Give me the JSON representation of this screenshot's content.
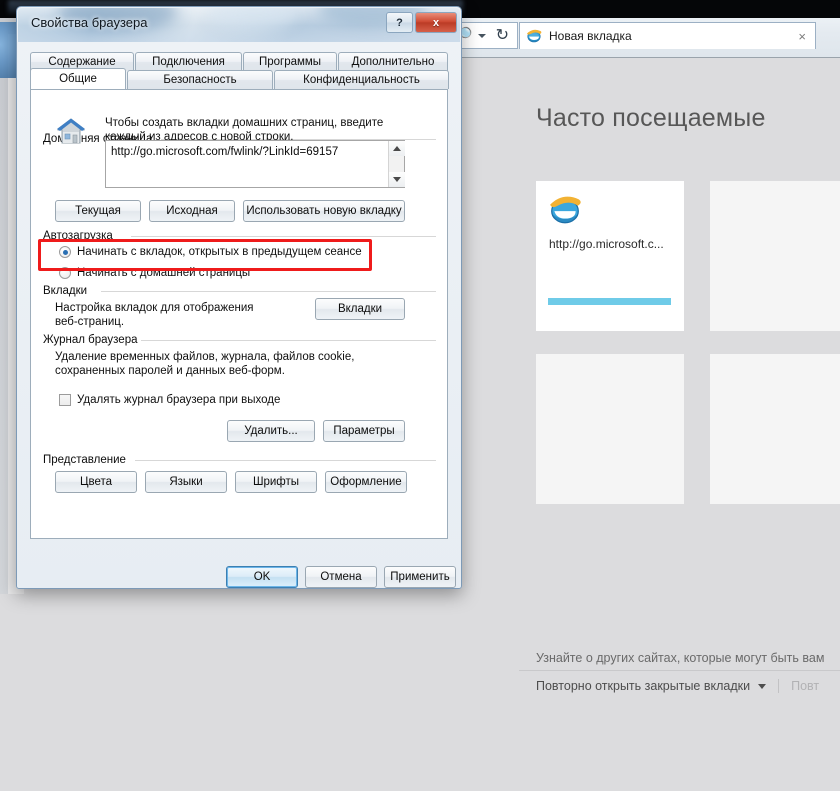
{
  "browser": {
    "tab_title": "Новая вкладка",
    "tab_close_label": "×",
    "search_icon": "search-icon",
    "refresh_icon": "refresh-icon",
    "ie_logo_icon": "internet-explorer-logo-icon"
  },
  "newtab_page": {
    "heading": "Часто посещаемые",
    "tiles": [
      {
        "label": "http://go.microsoft.c...",
        "has_icon": true,
        "accent": "#6fcbe8"
      },
      {
        "label": "",
        "has_icon": false,
        "accent": ""
      },
      {
        "label": "",
        "has_icon": false,
        "accent": ""
      },
      {
        "label": "",
        "has_icon": false,
        "accent": ""
      }
    ],
    "suggestion_text": "Узнайте о других сайтах, которые могут быть вам",
    "reopen_closed_tabs": "Повторно открыть закрытые вкладки",
    "reopen_muted": "Повт"
  },
  "dialog": {
    "title": "Свойства браузера",
    "help_button": "?",
    "close_button": "x",
    "tabs_row1": [
      {
        "label": "Содержание",
        "active": false
      },
      {
        "label": "Подключения",
        "active": false
      },
      {
        "label": "Программы",
        "active": false
      },
      {
        "label": "Дополнительно",
        "active": false
      }
    ],
    "tabs_row2": [
      {
        "label": "Общие",
        "active": true
      },
      {
        "label": "Безопасность",
        "active": false
      },
      {
        "label": "Конфиденциальность",
        "active": false
      }
    ],
    "homepage": {
      "group_label": "Домашняя страница",
      "description": "Чтобы создать вкладки домашних страниц, введите\nкаждый из адресов с новой строки.",
      "url_value": "http://go.microsoft.com/fwlink/?LinkId=69157",
      "buttons": [
        "Текущая",
        "Исходная",
        "Использовать новую вкладку"
      ]
    },
    "startup": {
      "group_label": "Автозагрузка",
      "options": [
        {
          "label": "Начинать с вкладок, открытых в предыдущем сеансе",
          "checked": true
        },
        {
          "label": "Начинать с домашней страницы",
          "checked": false
        }
      ]
    },
    "tabs_section": {
      "group_label": "Вкладки",
      "description": "Настройка вкладок для отображения\nвеб-страниц.",
      "button": "Вкладки"
    },
    "history": {
      "group_label": "Журнал браузера",
      "description": "Удаление временных файлов, журнала, файлов cookie,\nсохраненных паролей и данных веб-форм.",
      "checkbox_label": "Удалять журнал браузера при выходе",
      "checkbox_checked": false,
      "buttons": [
        "Удалить...",
        "Параметры"
      ]
    },
    "appearance": {
      "group_label": "Представление",
      "buttons": [
        "Цвета",
        "Языки",
        "Шрифты",
        "Оформление"
      ]
    },
    "footer_buttons": [
      {
        "label": "OK",
        "primary": true
      },
      {
        "label": "Отмена",
        "primary": false
      },
      {
        "label": "Применить",
        "primary": false
      }
    ]
  },
  "annotation": {
    "highlight_color": "#ef1b1b",
    "highlight_target": "startup-option-previous-session"
  }
}
